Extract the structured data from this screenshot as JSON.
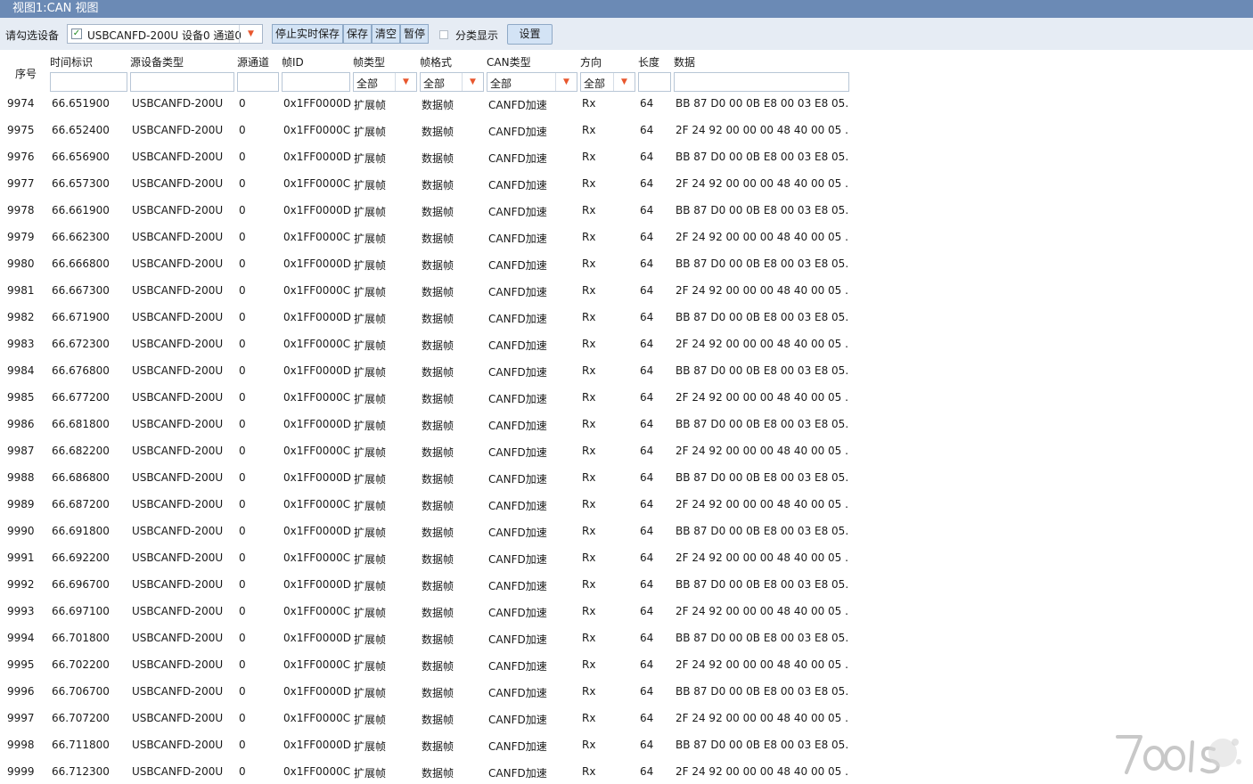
{
  "window": {
    "title": "视图1:CAN 视图"
  },
  "toolbar": {
    "device_label": "请勾选设备",
    "device_value": "USBCANFD-200U 设备0 通道0",
    "stop_save_label": "停止实时保存",
    "save_label": "保存",
    "clear_label": "清空",
    "pause_label": "暂停",
    "classify_label": "分类显示",
    "settings_label": "设置"
  },
  "columns": {
    "seq": "序号",
    "time": "时间标识",
    "device": "源设备类型",
    "channel": "源通道",
    "frame_id": "帧ID",
    "frame_type": "帧类型",
    "frame_format": "帧格式",
    "can_type": "CAN类型",
    "direction": "方向",
    "length": "长度",
    "data": "数据"
  },
  "filters": {
    "frame_type": "全部",
    "frame_format": "全部",
    "can_type": "全部",
    "direction": "全部"
  },
  "rows": [
    {
      "seq": "9974",
      "time": "66.651900",
      "device": "USBCANFD-200U",
      "channel": "0",
      "id": "0x1FF0000D",
      "ftype": "扩展帧",
      "ffmt": "数据帧",
      "can": "CANFD加速",
      "dir": "Rx",
      "len": "64",
      "data": "BB 87 D0 00 0B E8 00 03 E8 05..."
    },
    {
      "seq": "9975",
      "time": "66.652400",
      "device": "USBCANFD-200U",
      "channel": "0",
      "id": "0x1FF0000C",
      "ftype": "扩展帧",
      "ffmt": "数据帧",
      "can": "CANFD加速",
      "dir": "Rx",
      "len": "64",
      "data": "2F 24 92 00 00 00 48 40 00 05 ..."
    },
    {
      "seq": "9976",
      "time": "66.656900",
      "device": "USBCANFD-200U",
      "channel": "0",
      "id": "0x1FF0000D",
      "ftype": "扩展帧",
      "ffmt": "数据帧",
      "can": "CANFD加速",
      "dir": "Rx",
      "len": "64",
      "data": "BB 87 D0 00 0B E8 00 03 E8 05..."
    },
    {
      "seq": "9977",
      "time": "66.657300",
      "device": "USBCANFD-200U",
      "channel": "0",
      "id": "0x1FF0000C",
      "ftype": "扩展帧",
      "ffmt": "数据帧",
      "can": "CANFD加速",
      "dir": "Rx",
      "len": "64",
      "data": "2F 24 92 00 00 00 48 40 00 05 ..."
    },
    {
      "seq": "9978",
      "time": "66.661900",
      "device": "USBCANFD-200U",
      "channel": "0",
      "id": "0x1FF0000D",
      "ftype": "扩展帧",
      "ffmt": "数据帧",
      "can": "CANFD加速",
      "dir": "Rx",
      "len": "64",
      "data": "BB 87 D0 00 0B E8 00 03 E8 05..."
    },
    {
      "seq": "9979",
      "time": "66.662300",
      "device": "USBCANFD-200U",
      "channel": "0",
      "id": "0x1FF0000C",
      "ftype": "扩展帧",
      "ffmt": "数据帧",
      "can": "CANFD加速",
      "dir": "Rx",
      "len": "64",
      "data": "2F 24 92 00 00 00 48 40 00 05 ..."
    },
    {
      "seq": "9980",
      "time": "66.666800",
      "device": "USBCANFD-200U",
      "channel": "0",
      "id": "0x1FF0000D",
      "ftype": "扩展帧",
      "ffmt": "数据帧",
      "can": "CANFD加速",
      "dir": "Rx",
      "len": "64",
      "data": "BB 87 D0 00 0B E8 00 03 E8 05..."
    },
    {
      "seq": "9981",
      "time": "66.667300",
      "device": "USBCANFD-200U",
      "channel": "0",
      "id": "0x1FF0000C",
      "ftype": "扩展帧",
      "ffmt": "数据帧",
      "can": "CANFD加速",
      "dir": "Rx",
      "len": "64",
      "data": "2F 24 92 00 00 00 48 40 00 05 ..."
    },
    {
      "seq": "9982",
      "time": "66.671900",
      "device": "USBCANFD-200U",
      "channel": "0",
      "id": "0x1FF0000D",
      "ftype": "扩展帧",
      "ffmt": "数据帧",
      "can": "CANFD加速",
      "dir": "Rx",
      "len": "64",
      "data": "BB 87 D0 00 0B E8 00 03 E8 05..."
    },
    {
      "seq": "9983",
      "time": "66.672300",
      "device": "USBCANFD-200U",
      "channel": "0",
      "id": "0x1FF0000C",
      "ftype": "扩展帧",
      "ffmt": "数据帧",
      "can": "CANFD加速",
      "dir": "Rx",
      "len": "64",
      "data": "2F 24 92 00 00 00 48 40 00 05 ..."
    },
    {
      "seq": "9984",
      "time": "66.676800",
      "device": "USBCANFD-200U",
      "channel": "0",
      "id": "0x1FF0000D",
      "ftype": "扩展帧",
      "ffmt": "数据帧",
      "can": "CANFD加速",
      "dir": "Rx",
      "len": "64",
      "data": "BB 87 D0 00 0B E8 00 03 E8 05..."
    },
    {
      "seq": "9985",
      "time": "66.677200",
      "device": "USBCANFD-200U",
      "channel": "0",
      "id": "0x1FF0000C",
      "ftype": "扩展帧",
      "ffmt": "数据帧",
      "can": "CANFD加速",
      "dir": "Rx",
      "len": "64",
      "data": "2F 24 92 00 00 00 48 40 00 05 ..."
    },
    {
      "seq": "9986",
      "time": "66.681800",
      "device": "USBCANFD-200U",
      "channel": "0",
      "id": "0x1FF0000D",
      "ftype": "扩展帧",
      "ffmt": "数据帧",
      "can": "CANFD加速",
      "dir": "Rx",
      "len": "64",
      "data": "BB 87 D0 00 0B E8 00 03 E8 05..."
    },
    {
      "seq": "9987",
      "time": "66.682200",
      "device": "USBCANFD-200U",
      "channel": "0",
      "id": "0x1FF0000C",
      "ftype": "扩展帧",
      "ffmt": "数据帧",
      "can": "CANFD加速",
      "dir": "Rx",
      "len": "64",
      "data": "2F 24 92 00 00 00 48 40 00 05 ..."
    },
    {
      "seq": "9988",
      "time": "66.686800",
      "device": "USBCANFD-200U",
      "channel": "0",
      "id": "0x1FF0000D",
      "ftype": "扩展帧",
      "ffmt": "数据帧",
      "can": "CANFD加速",
      "dir": "Rx",
      "len": "64",
      "data": "BB 87 D0 00 0B E8 00 03 E8 05..."
    },
    {
      "seq": "9989",
      "time": "66.687200",
      "device": "USBCANFD-200U",
      "channel": "0",
      "id": "0x1FF0000C",
      "ftype": "扩展帧",
      "ffmt": "数据帧",
      "can": "CANFD加速",
      "dir": "Rx",
      "len": "64",
      "data": "2F 24 92 00 00 00 48 40 00 05 ..."
    },
    {
      "seq": "9990",
      "time": "66.691800",
      "device": "USBCANFD-200U",
      "channel": "0",
      "id": "0x1FF0000D",
      "ftype": "扩展帧",
      "ffmt": "数据帧",
      "can": "CANFD加速",
      "dir": "Rx",
      "len": "64",
      "data": "BB 87 D0 00 0B E8 00 03 E8 05..."
    },
    {
      "seq": "9991",
      "time": "66.692200",
      "device": "USBCANFD-200U",
      "channel": "0",
      "id": "0x1FF0000C",
      "ftype": "扩展帧",
      "ffmt": "数据帧",
      "can": "CANFD加速",
      "dir": "Rx",
      "len": "64",
      "data": "2F 24 92 00 00 00 48 40 00 05 ..."
    },
    {
      "seq": "9992",
      "time": "66.696700",
      "device": "USBCANFD-200U",
      "channel": "0",
      "id": "0x1FF0000D",
      "ftype": "扩展帧",
      "ffmt": "数据帧",
      "can": "CANFD加速",
      "dir": "Rx",
      "len": "64",
      "data": "BB 87 D0 00 0B E8 00 03 E8 05..."
    },
    {
      "seq": "9993",
      "time": "66.697100",
      "device": "USBCANFD-200U",
      "channel": "0",
      "id": "0x1FF0000C",
      "ftype": "扩展帧",
      "ffmt": "数据帧",
      "can": "CANFD加速",
      "dir": "Rx",
      "len": "64",
      "data": "2F 24 92 00 00 00 48 40 00 05 ..."
    },
    {
      "seq": "9994",
      "time": "66.701800",
      "device": "USBCANFD-200U",
      "channel": "0",
      "id": "0x1FF0000D",
      "ftype": "扩展帧",
      "ffmt": "数据帧",
      "can": "CANFD加速",
      "dir": "Rx",
      "len": "64",
      "data": "BB 87 D0 00 0B E8 00 03 E8 05..."
    },
    {
      "seq": "9995",
      "time": "66.702200",
      "device": "USBCANFD-200U",
      "channel": "0",
      "id": "0x1FF0000C",
      "ftype": "扩展帧",
      "ffmt": "数据帧",
      "can": "CANFD加速",
      "dir": "Rx",
      "len": "64",
      "data": "2F 24 92 00 00 00 48 40 00 05 ..."
    },
    {
      "seq": "9996",
      "time": "66.706700",
      "device": "USBCANFD-200U",
      "channel": "0",
      "id": "0x1FF0000D",
      "ftype": "扩展帧",
      "ffmt": "数据帧",
      "can": "CANFD加速",
      "dir": "Rx",
      "len": "64",
      "data": "BB 87 D0 00 0B E8 00 03 E8 05..."
    },
    {
      "seq": "9997",
      "time": "66.707200",
      "device": "USBCANFD-200U",
      "channel": "0",
      "id": "0x1FF0000C",
      "ftype": "扩展帧",
      "ffmt": "数据帧",
      "can": "CANFD加速",
      "dir": "Rx",
      "len": "64",
      "data": "2F 24 92 00 00 00 48 40 00 05 ..."
    },
    {
      "seq": "9998",
      "time": "66.711800",
      "device": "USBCANFD-200U",
      "channel": "0",
      "id": "0x1FF0000D",
      "ftype": "扩展帧",
      "ffmt": "数据帧",
      "can": "CANFD加速",
      "dir": "Rx",
      "len": "64",
      "data": "BB 87 D0 00 0B E8 00 03 E8 05..."
    },
    {
      "seq": "9999",
      "time": "66.712300",
      "device": "USBCANFD-200U",
      "channel": "0",
      "id": "0x1FF0000C",
      "ftype": "扩展帧",
      "ffmt": "数据帧",
      "can": "CANFD加速",
      "dir": "Rx",
      "len": "64",
      "data": "2F 24 92 00 00 00 48 40 00 05 ..."
    }
  ],
  "watermark": {
    "text": "7ools"
  },
  "colors": {
    "titlebar": "#6b8ab5",
    "toolbar": "#e6ecf4",
    "button": "#d3e3f5",
    "dropdown_arrow": "#e8572e"
  }
}
